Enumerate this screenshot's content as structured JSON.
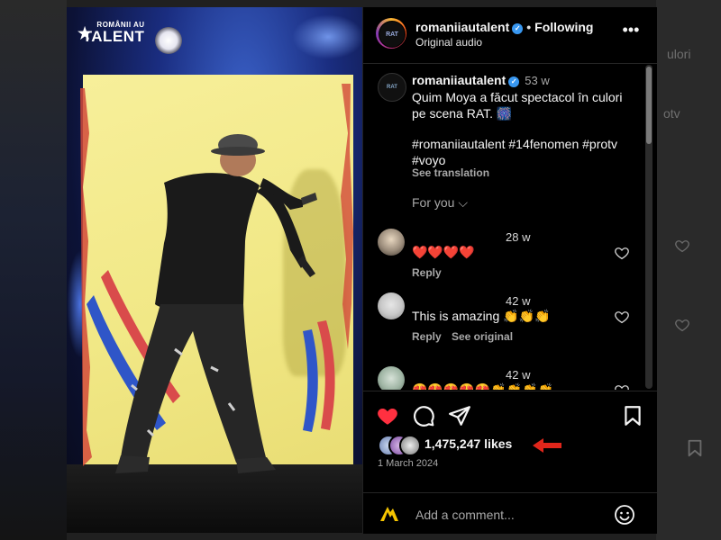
{
  "background": {
    "ghost_text_1": "ulori",
    "ghost_text_2": "otv"
  },
  "media": {
    "show_logo": {
      "line1": "ROMÂNII AU",
      "line2": "TALENT",
      "star": "★"
    }
  },
  "header": {
    "username": "romaniiautalent",
    "verified_mark": "✓",
    "separator": "•",
    "follow_status": "Following",
    "audio": "Original audio",
    "more": "•••",
    "avatar_text": "RAT"
  },
  "caption": {
    "avatar_text": "RAT",
    "username": "romaniiautalent",
    "time": "53 w",
    "text": "Quim Moya a făcut spectacol în culori pe scena RAT. 🎆",
    "hashtags": "#romaniiautalent #14fenomen #protv #voyo",
    "see_translation": "See translation",
    "for_you": "For you ⌵"
  },
  "comments": [
    {
      "time": "28 w",
      "text": "❤️❤️❤️❤️",
      "reply": "Reply",
      "see_original": "",
      "avatar_color": "#9a8b7a"
    },
    {
      "time": "42 w",
      "text": "This is amazing 👏👏👏",
      "reply": "Reply",
      "see_original": "See original",
      "avatar_color": "#c9c9c9"
    },
    {
      "time": "42 w",
      "text": "😍😍😍😍😍👏👏👏👏",
      "reply": "",
      "see_original": "",
      "avatar_color": "#9fb5a4"
    }
  ],
  "colors": {
    "like_red": "#ff3040",
    "verified_blue": "#3897f0",
    "arrow_red": "#e0261b"
  },
  "actions": {
    "likes_count": "1,475,247 likes",
    "date": "1 March 2024"
  },
  "comment_box": {
    "placeholder": "Add a comment..."
  }
}
